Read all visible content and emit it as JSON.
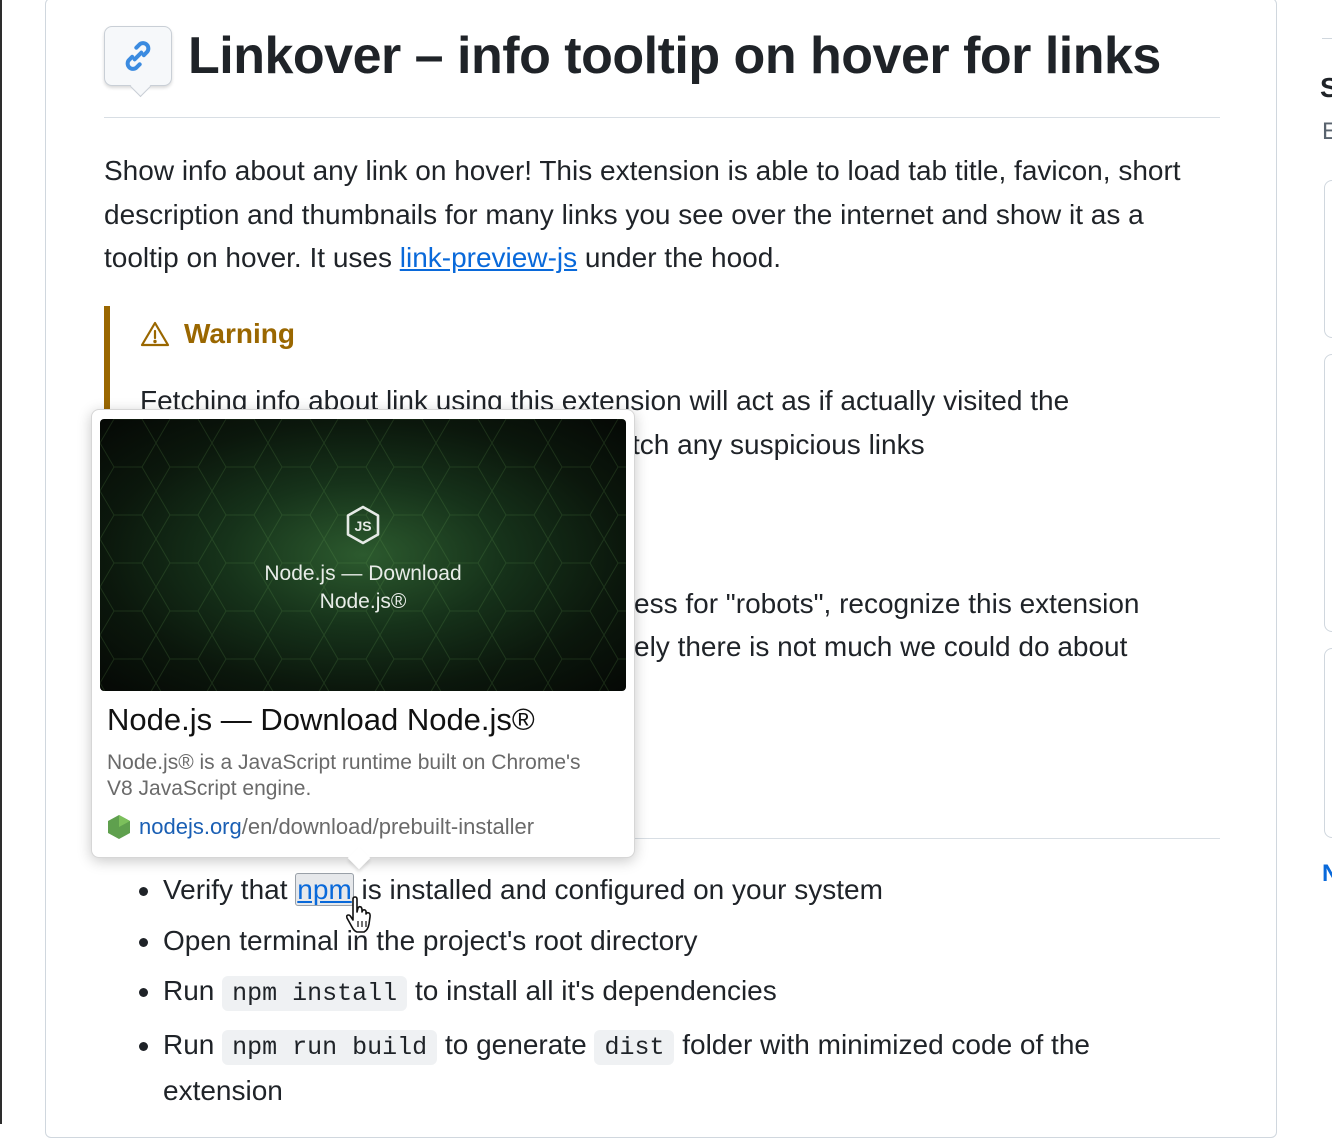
{
  "readme": {
    "title": "Linkover – info tooltip on hover for links",
    "intro_before": "Show info about any link on hover! This extension is able to load tab title, favicon, short description and thumbnails for many links you see over the internet and show it as a tooltip on hover. It uses ",
    "intro_link": "link-preview-js",
    "intro_after": " under the hood.",
    "warning": {
      "title": "Warning",
      "line1": "Fetching info about link using this extension will act as if actually visited the",
      "line2_visible": "tch any suspicious links",
      "line3_visible": "ess for \"robots\", recognize this extension",
      "line4_visible": "ely there is not much we could do about"
    },
    "steps": [
      {
        "before": "Verify that ",
        "link": "npm",
        "after": " is installed and configured on your system"
      },
      {
        "text": "Open terminal in the project's root directory"
      },
      {
        "before": "Run ",
        "code": "npm install",
        "after": " to install all it's dependencies"
      },
      {
        "before": "Run ",
        "code": "npm run build",
        "middle": " to generate ",
        "code2": "dist",
        "after": " folder with minimized code of the",
        "cont": "extension"
      }
    ]
  },
  "tooltip": {
    "thumbnail_text_line1": "Node.js — Download",
    "thumbnail_text_line2": "Node.js®",
    "title": "Node.js — Download Node.js®",
    "description": "Node.js® is a JavaScript runtime built on Chrome's V8 JavaScript engine.",
    "url_domain": "nodejs.org",
    "url_path": "/en/download/prebuilt-installer"
  },
  "sidebar": {
    "letter1": "S",
    "letter2": "E",
    "link_letter": "N"
  },
  "colors": {
    "accent_link": "#0969da",
    "warning": "#9a6700",
    "text": "#1f2328",
    "node_green": "#5fa04e"
  }
}
